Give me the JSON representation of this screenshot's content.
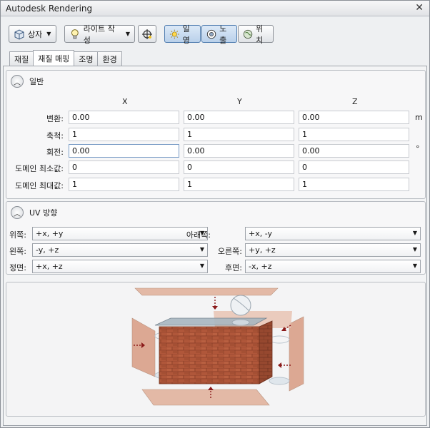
{
  "window": {
    "title": "Autodesk Rendering"
  },
  "toolbar": {
    "box_label": "상자",
    "light_label": "라이트 작성",
    "sun_label": "일영",
    "exposure_label": "노출",
    "location_label": "위치"
  },
  "tabs": [
    {
      "label": "재질"
    },
    {
      "label": "재질 매핑"
    },
    {
      "label": "조명"
    },
    {
      "label": "환경"
    }
  ],
  "general": {
    "title": "일반",
    "columns": [
      "X",
      "Y",
      "Z"
    ],
    "rows": [
      {
        "label": "변환:",
        "values": [
          "0.00",
          "0.00",
          "0.00"
        ],
        "unit": "m"
      },
      {
        "label": "축척:",
        "values": [
          "1",
          "1",
          "1"
        ],
        "unit": ""
      },
      {
        "label": "회전:",
        "values": [
          "0.00",
          "0.00",
          "0.00"
        ],
        "unit": "°"
      },
      {
        "label": "도메인 최소값:",
        "values": [
          "0",
          "0",
          "0"
        ],
        "unit": ""
      },
      {
        "label": "도메인 최대값:",
        "values": [
          "1",
          "1",
          "1"
        ],
        "unit": ""
      }
    ]
  },
  "uv": {
    "title": "UV 방향",
    "top_label": "위쪽:",
    "top_value": "+x, +y",
    "bottom_label": "아래쪽:",
    "bottom_value": "+x, -y",
    "left_label": "왼쪽:",
    "left_value": "-y, +z",
    "right_label": "오른쪽:",
    "right_value": "+y, +z",
    "front_label": "정면:",
    "front_value": "+x, +z",
    "back_label": "후면:",
    "back_value": "-x, +z"
  },
  "colors": {
    "accent": "#4f7db0",
    "brick": "#b0573a",
    "plane": "#e3b9a6"
  }
}
